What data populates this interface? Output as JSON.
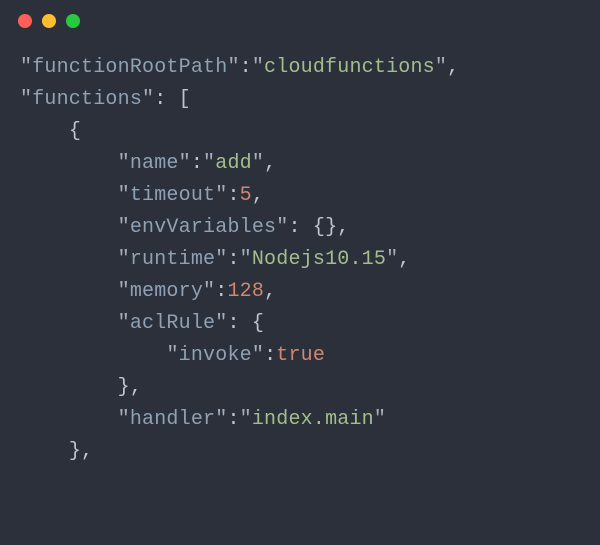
{
  "titlebar": {
    "close": "close",
    "minimize": "minimize",
    "zoom": "zoom"
  },
  "code": {
    "k_functionRootPath": "functionRootPath",
    "v_functionRootPath": "cloudfunctions",
    "k_functions": "functions",
    "k_name": "name",
    "v_name": "add",
    "k_timeout": "timeout",
    "v_timeout": "5",
    "k_envVariables": "envVariables",
    "v_envVariables": "{}",
    "k_runtime": "runtime",
    "v_runtime": "Nodejs10.15",
    "k_memory": "memory",
    "v_memory": "128",
    "k_aclRule": "aclRule",
    "k_invoke": "invoke",
    "v_invoke": "true",
    "k_handler": "handler",
    "v_handler": "index.main"
  }
}
